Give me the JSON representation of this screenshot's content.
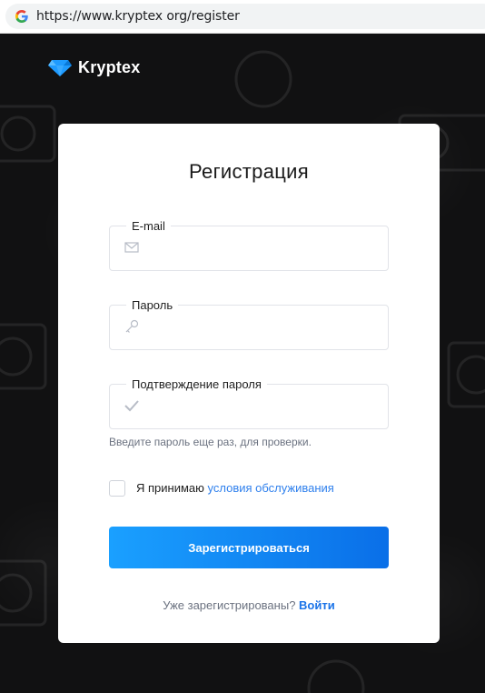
{
  "browser": {
    "url": "https://www.kryptex org/register"
  },
  "brand": {
    "name": "Kryptex",
    "accent_color": "#1e9bff"
  },
  "form": {
    "title": "Регистрация",
    "fields": [
      {
        "label": "E-mail",
        "value": "",
        "icon": "envelope-icon"
      },
      {
        "label": "Пароль",
        "value": "",
        "icon": "key-icon"
      },
      {
        "label": "Подтверждение пароля",
        "value": "",
        "icon": "check-icon"
      }
    ],
    "confirm_hint": "Введите пароль еще раз, для проверки.",
    "terms_prefix": "Я принимаю",
    "terms_link": "условия обслуживания",
    "terms_checked": false,
    "submit_label": "Зарегистрироваться",
    "login_prompt": "Уже зарегистрированы?",
    "login_link": "Войти"
  }
}
